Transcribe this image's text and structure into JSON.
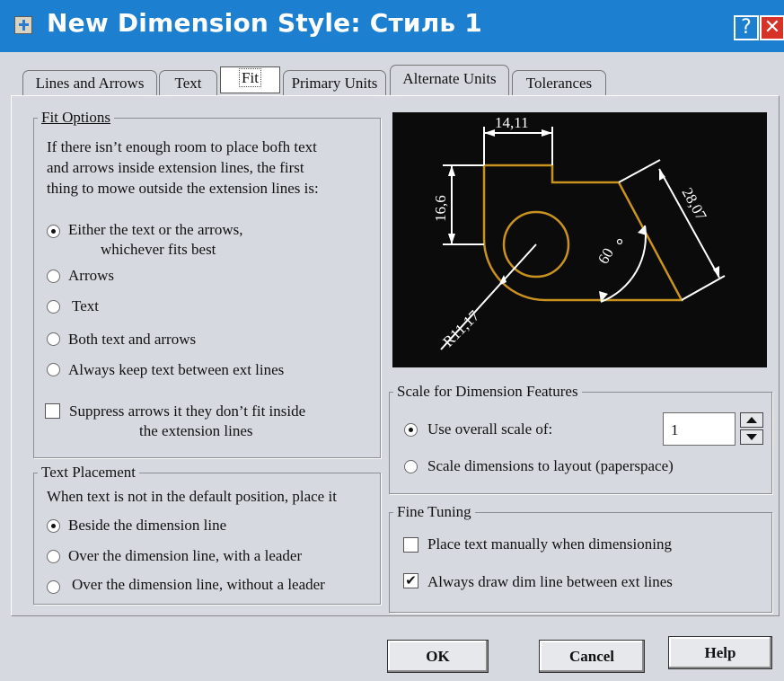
{
  "window": {
    "title": "New Dimension Style: Стиль 1",
    "help": "?",
    "close": "✕"
  },
  "tabs": [
    "Lines and Arrows",
    "Text",
    "Fit",
    "Primary Units",
    "Alternate Units",
    "Tolerances"
  ],
  "fit_options": {
    "legend": "Fit Options",
    "desc": [
      "If there isn’t enough room to place bofh text",
      "and arrows inside extension lines, the first",
      "thing to mowe outside the extension lines is:"
    ],
    "options": [
      "Either the text or the arrows,",
      "whichever fits best",
      "Arrows",
      "Text",
      "Both text and arrows",
      "Always keep text between ext lines"
    ],
    "selected": "Either the text or the arrows, whichever fits best",
    "suppress": [
      "Suppress arrows it they don’t fit inside",
      "the extension lines"
    ],
    "suppress_checked": false
  },
  "text_placement": {
    "legend": "Text Placement",
    "desc": "When text is not in the default position, place it",
    "options": [
      "Beside the dimension line",
      "Over the dimension line, with a leader",
      "Over the dimension line, without a leader"
    ],
    "selected": "Beside the dimension line"
  },
  "preview": {
    "dim_top": "14,11",
    "dim_left": "16,6",
    "dim_diag": "28,07",
    "angle": "60",
    "radius": "R11,17"
  },
  "scale": {
    "legend": "Scale for Dimension Features",
    "overall": "Use overall scale of:",
    "layout": "Scale dimensions to layout (paperspace)",
    "value": "1",
    "selected": "Use overall scale of:"
  },
  "fine_tuning": {
    "legend": "Fine Tuning",
    "manual": "Place text manually when dimensioning",
    "manual_checked": false,
    "always": "Always draw dim line between ext lines",
    "always_checked": true,
    "check_mark": "✔"
  },
  "buttons": {
    "ok": "OK",
    "cancel": "Cancel",
    "help": "Help"
  },
  "colors": {
    "titlebar": "#1c7fd0",
    "close": "#d63228",
    "drawing": "#c9921e",
    "dialog": "#d6dae0"
  }
}
